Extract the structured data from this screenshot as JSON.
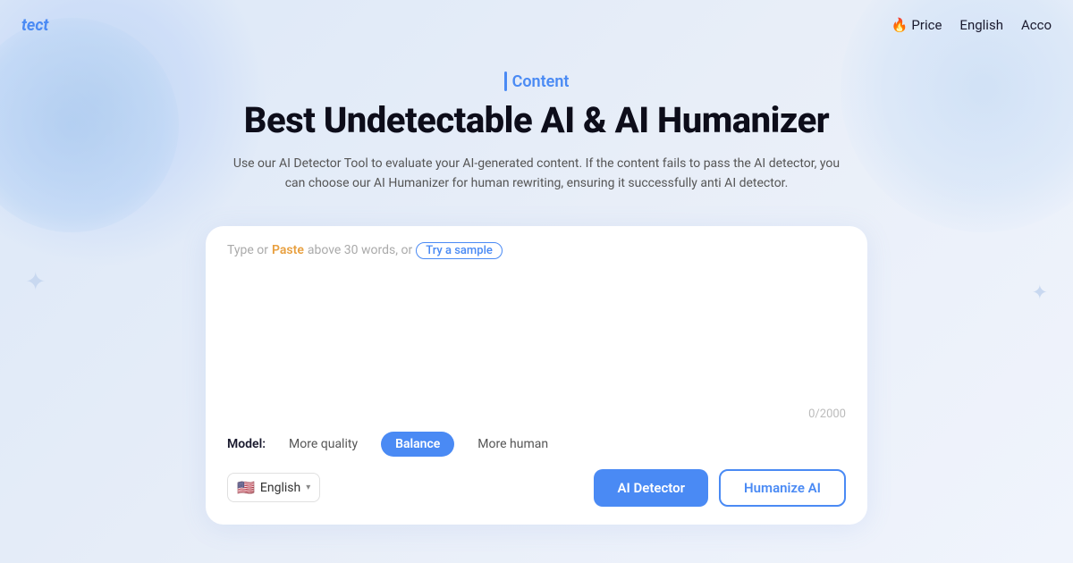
{
  "navbar": {
    "logo": "tect",
    "price_label": "Price",
    "price_icon": "🔥",
    "language_label": "English",
    "account_label": "Acco"
  },
  "hero": {
    "subtitle_bar": "|",
    "subtitle": "Content",
    "title": "Best Undetectable AI & AI Humanizer",
    "description": "Use our AI Detector Tool to evaluate your AI-generated content. If the content fails to pass the AI detector, you can choose our AI Humanizer for human rewriting, ensuring it successfully anti AI detector."
  },
  "card": {
    "hint_type": "Type or",
    "hint_paste": "Paste",
    "hint_middle": "above 30 words, or",
    "hint_sample": "Try a sample",
    "textarea_placeholder": "",
    "char_count": "0/2000",
    "model_label": "Model:",
    "models": [
      {
        "label": "More quality",
        "active": false
      },
      {
        "label": "Balance",
        "active": true
      },
      {
        "label": "More human",
        "active": false
      }
    ],
    "language_flag": "🇺🇸",
    "language_text": "English",
    "btn_ai_detector": "AI Detector",
    "btn_humanize": "Humanize AI"
  }
}
